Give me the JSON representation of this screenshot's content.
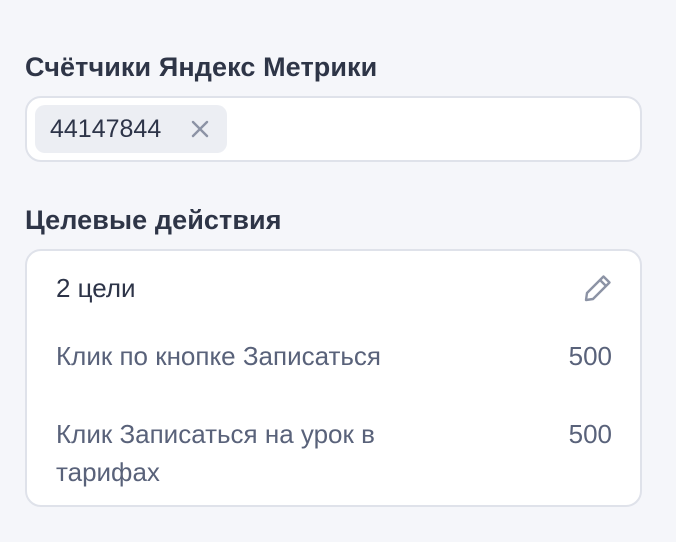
{
  "counters": {
    "label": "Счётчики Яндекс Метрики",
    "chips": [
      {
        "value": "44147844"
      }
    ]
  },
  "goals": {
    "label": "Целевые действия",
    "count_text": "2 цели",
    "items": [
      {
        "name": "Клик по кнопке Записаться",
        "value": "500"
      },
      {
        "name": "Клик Записаться на урок в тарифах",
        "value": "500"
      }
    ]
  },
  "colors": {
    "background": "#f5f6fa",
    "text_primary": "#2d3448",
    "text_secondary": "#59627a",
    "border": "#dfe2ea",
    "chip_bg": "#eceef3",
    "icon": "#8c93a5"
  },
  "icons": {
    "chip_remove": "close-icon",
    "goals_edit": "pencil-icon"
  }
}
